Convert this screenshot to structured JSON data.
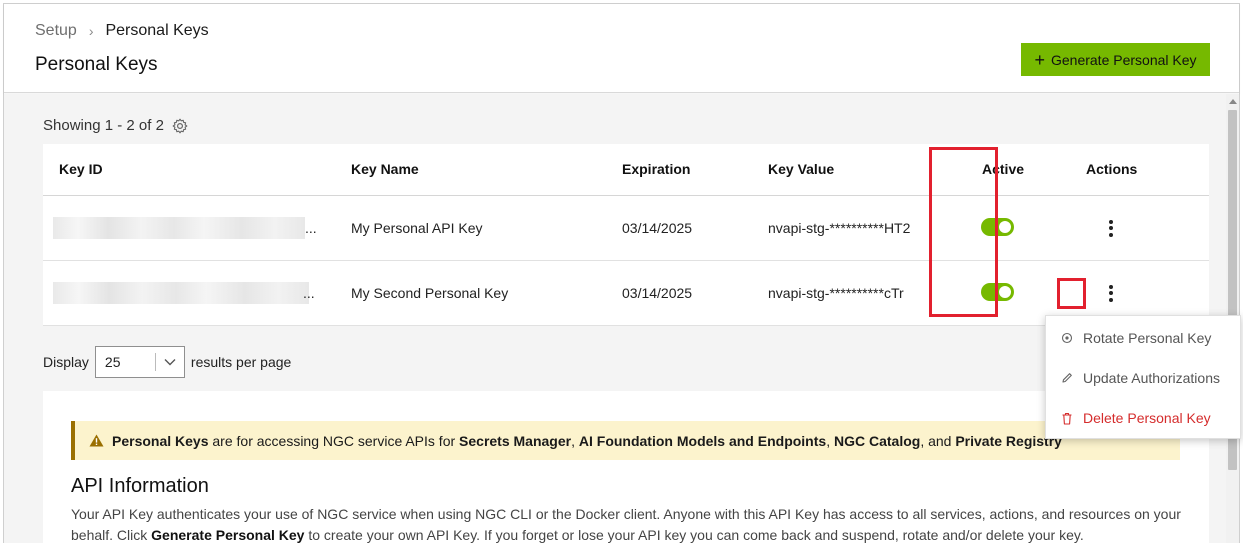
{
  "breadcrumb": {
    "root": "Setup",
    "separator": "›",
    "current": "Personal Keys"
  },
  "page_title": "Personal Keys",
  "generate_button": {
    "label": "Generate Personal Key",
    "icon": "plus-icon"
  },
  "showing": {
    "text": "Showing 1 - 2 of 2",
    "icon": "gear-icon"
  },
  "table": {
    "columns": [
      "Key ID",
      "Key Name",
      "Expiration",
      "Key Value",
      "Active",
      "Actions"
    ],
    "rows": [
      {
        "key_id_suffix": "...",
        "key_name": "My Personal API Key",
        "expiration": "03/14/2025",
        "key_value": "nvapi-stg-**********HT2",
        "active": true
      },
      {
        "key_id_suffix": "...",
        "key_name": "My Second Personal Key",
        "expiration": "03/14/2025",
        "key_value": "nvapi-stg-**********cTr",
        "active": true
      }
    ]
  },
  "pagination": {
    "display_label": "Display",
    "per_page": "25",
    "suffix": "results per page"
  },
  "notice": {
    "parts": [
      "Personal Keys",
      " are for accessing NGC service APIs for ",
      "Secrets Manager",
      ", ",
      "AI Foundation Models and Endpoints",
      ", ",
      "NGC Catalog",
      ", and ",
      "Private Registry"
    ]
  },
  "api_info": {
    "title": "API Information",
    "text_1": "Your API Key authenticates your use of NGC service when using NGC CLI or the Docker client. Anyone with this API Key has access to all services, actions, and resources on your behalf. Click ",
    "text_bold": "Generate Personal Key",
    "text_2": " to create your own API Key. If you forget or lose your API key you can come back and suspend, rotate and/or delete your key."
  },
  "menu": {
    "items": [
      {
        "label": "Rotate Personal Key",
        "icon": "rotate-icon"
      },
      {
        "label": "Update Authorizations",
        "icon": "pencil-icon"
      },
      {
        "label": "Delete Personal Key",
        "icon": "trash-icon"
      }
    ]
  },
  "colors": {
    "accent": "#76b900",
    "highlight": "#e2202e",
    "danger": "#d52c2c",
    "warning_bg": "#fcf3cd"
  }
}
